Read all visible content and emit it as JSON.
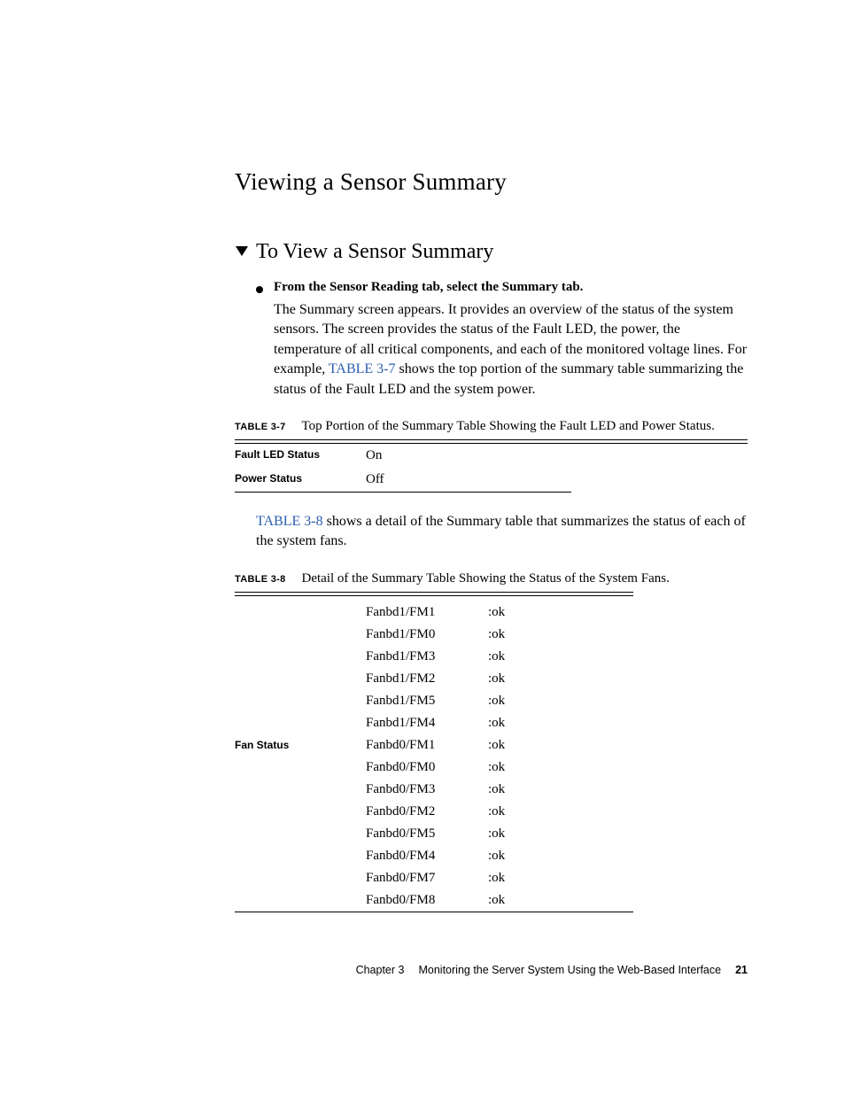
{
  "section_title": "Viewing a Sensor Summary",
  "step_title": "To View a Sensor Summary",
  "bullet_text": "From the Sensor Reading tab, select the Summary tab.",
  "para1_a": "The Summary screen appears. It provides an overview of the status of the system sensors. The screen provides the status of the Fault LED, the power, the temperature of all critical components, and each of the monitored voltage lines. For example, ",
  "para1_link": "TABLE 3-7",
  "para1_b": " shows the top portion of the summary table summarizing the status of the Fault LED and the system power.",
  "table37": {
    "label": "TABLE 3-7",
    "caption": "Top Portion of the Summary Table Showing the Fault LED and Power Status.",
    "rows": [
      {
        "label": "Fault LED Status",
        "value": "On"
      },
      {
        "label": "Power Status",
        "value": "Off"
      }
    ]
  },
  "para2_link": "TABLE 3-8",
  "para2_rest": " shows a detail of the Summary table that summarizes the status of each of the system fans.",
  "table38": {
    "label": "TABLE 3-8",
    "caption": "Detail of the Summary Table Showing the Status of the System Fans.",
    "group_label": "Fan Status",
    "rows": [
      {
        "name": "Fanbd1/FM1",
        "status": ":ok"
      },
      {
        "name": "Fanbd1/FM0",
        "status": ":ok"
      },
      {
        "name": "Fanbd1/FM3",
        "status": ":ok"
      },
      {
        "name": "Fanbd1/FM2",
        "status": ":ok"
      },
      {
        "name": "Fanbd1/FM5",
        "status": ":ok"
      },
      {
        "name": "Fanbd1/FM4",
        "status": ":ok"
      },
      {
        "name": "Fanbd0/FM1",
        "status": ":ok"
      },
      {
        "name": "Fanbd0/FM0",
        "status": ":ok"
      },
      {
        "name": "Fanbd0/FM3",
        "status": ":ok"
      },
      {
        "name": "Fanbd0/FM2",
        "status": ":ok"
      },
      {
        "name": "Fanbd0/FM5",
        "status": ":ok"
      },
      {
        "name": "Fanbd0/FM4",
        "status": ":ok"
      },
      {
        "name": "Fanbd0/FM7",
        "status": ":ok"
      },
      {
        "name": "Fanbd0/FM8",
        "status": ":ok"
      }
    ]
  },
  "footer": {
    "chapter": "Chapter 3",
    "title": "Monitoring the Server System Using the Web-Based Interface",
    "page": "21"
  }
}
